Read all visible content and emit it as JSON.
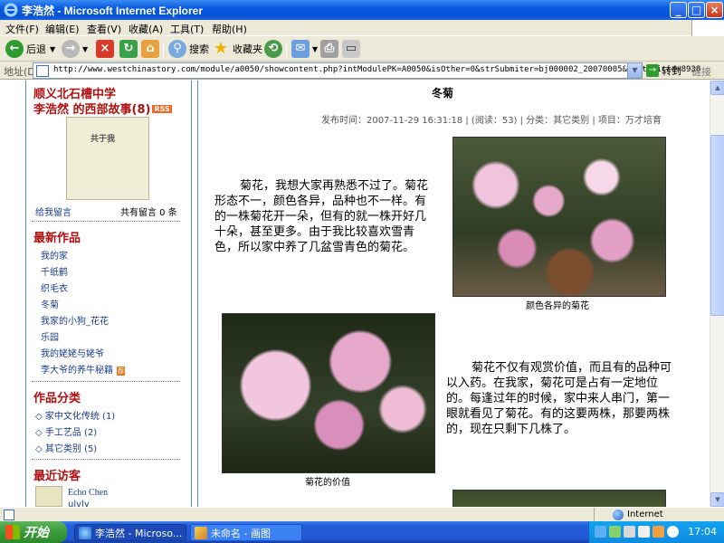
{
  "window": {
    "title": "李浩然 - Microsoft Internet Explorer",
    "min_glyph": "_",
    "max_glyph": "□",
    "close_glyph": "×"
  },
  "menu": [
    "文件(F)",
    "编辑(E)",
    "查看(V)",
    "收藏(A)",
    "工具(T)",
    "帮助(H)"
  ],
  "toolbar": {
    "back": "后退",
    "search": "搜索",
    "favorites": "收藏夹"
  },
  "address": {
    "label": "地址(D)",
    "url": "http://www.westchinastory.com/module/a0050/showcontent.php?intModulePK=A0050&isOther=0&strSubmiter=bj000002_20070005&inttopicid=8938",
    "go": "转到",
    "links": "链接"
  },
  "sidebar": {
    "school": "顺义北石槽中学",
    "author_title": "李浩然 的西部故事(8)",
    "rss": "RSS",
    "avatar_caption": "共于我",
    "guestbook": "给我留言",
    "message_count": "共有留言 0 条",
    "latest_heading": "最新作品",
    "works": [
      "我的家",
      "千纸鹤",
      "织毛衣",
      "冬菊",
      "我家的小狗_花花",
      "乐园",
      "我的姥姥与姥爷",
      "李大爷的养牛秘籍"
    ],
    "new_badge": "荐",
    "category_heading": "作品分类",
    "categories": [
      "◇ 家中文化传统 (1)",
      "◇ 手工艺品 (2)",
      "◇ 其它类别 (5)"
    ],
    "visitors_heading": "最近访客",
    "visitors": [
      "Echo Chen",
      "ulvly"
    ]
  },
  "article": {
    "title": "冬菊",
    "meta": "发布时间：2007-11-29 16:31:18 | (阅读：53) | 分类：其它类别 | 项目：万才培育",
    "paragraph1": "菊花，我想大家再熟悉不过了。菊花形态不一，颜色各异，品种也不一样。有的一株菊花开一朵，但有的就一株开好几十朵，甚至更多。由于我比较喜欢雪青色，所以家中养了几盆雪青色的菊花。",
    "photo1_caption": "颜色各异的菊花",
    "photo2_caption": "菊花的价值",
    "paragraph2": "菊花不仅有观赏价值，而且有的品种可以入药。在我家，菊花可是占有一定地位的。每逢过年的时候，家中来人串门，第一眼就看见了菊花。有的这要两株，那要两株的，现在只剩下几株了。"
  },
  "status": {
    "zone": "Internet"
  },
  "taskbar": {
    "start": "开始",
    "tasks": [
      "李浩然 - Microso...",
      "未命名 - 画图"
    ],
    "clock": "17:04"
  },
  "colors": {
    "accent_red": "#b01010",
    "link_blue": "#1a3b8c",
    "xp_blue": "#0a5ae0",
    "start_green": "#3a9a39"
  }
}
